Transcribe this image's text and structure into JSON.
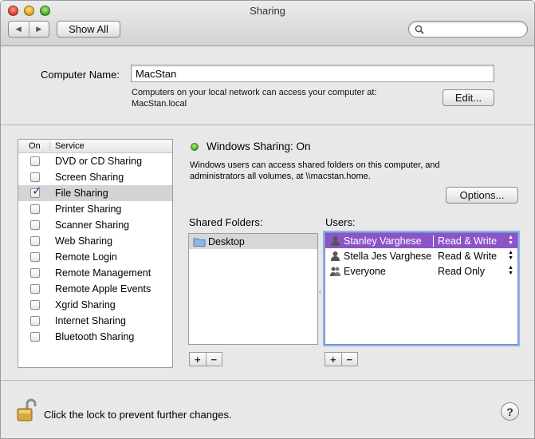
{
  "window": {
    "title": "Sharing"
  },
  "toolbar": {
    "show_all_label": "Show All",
    "back_icon": "back-arrow-icon",
    "forward_icon": "forward-arrow-icon"
  },
  "computer_name": {
    "label": "Computer Name:",
    "value": "MacStan",
    "description_line1": "Computers on your local network can access your computer at:",
    "description_line2": "MacStan.local",
    "edit_label": "Edit..."
  },
  "services": {
    "header_on": "On",
    "header_service": "Service",
    "items": [
      {
        "label": "DVD or CD Sharing",
        "checked": false
      },
      {
        "label": "Screen Sharing",
        "checked": false
      },
      {
        "label": "File Sharing",
        "checked": true
      },
      {
        "label": "Printer Sharing",
        "checked": false
      },
      {
        "label": "Scanner Sharing",
        "checked": false
      },
      {
        "label": "Web Sharing",
        "checked": false
      },
      {
        "label": "Remote Login",
        "checked": false
      },
      {
        "label": "Remote Management",
        "checked": false
      },
      {
        "label": "Remote Apple Events",
        "checked": false
      },
      {
        "label": "Xgrid Sharing",
        "checked": false
      },
      {
        "label": "Internet Sharing",
        "checked": false
      },
      {
        "label": "Bluetooth Sharing",
        "checked": false
      }
    ],
    "selected": "File Sharing"
  },
  "status": {
    "title": "Windows Sharing: On",
    "description_line1": "Windows users can access shared folders on this computer, and",
    "description_line2": "administrators all volumes, at \\\\macstan.home.",
    "options_label": "Options...",
    "status_color": "#45b520"
  },
  "shared_folders": {
    "label": "Shared Folders:",
    "items": [
      {
        "name": "Desktop"
      }
    ]
  },
  "users": {
    "label": "Users:",
    "items": [
      {
        "name": "Stanley Varghese",
        "permission": "Read & Write",
        "icon": "user-icon"
      },
      {
        "name": "Stella Jes Varghese",
        "permission": "Read & Write",
        "icon": "user-icon"
      },
      {
        "name": "Everyone",
        "permission": "Read Only",
        "icon": "group-icon"
      }
    ],
    "selection_color": "#8c55c7"
  },
  "buttons": {
    "add": "+",
    "remove": "−"
  },
  "footer": {
    "lock_text": "Click the lock to prevent further changes.",
    "help": "?"
  }
}
